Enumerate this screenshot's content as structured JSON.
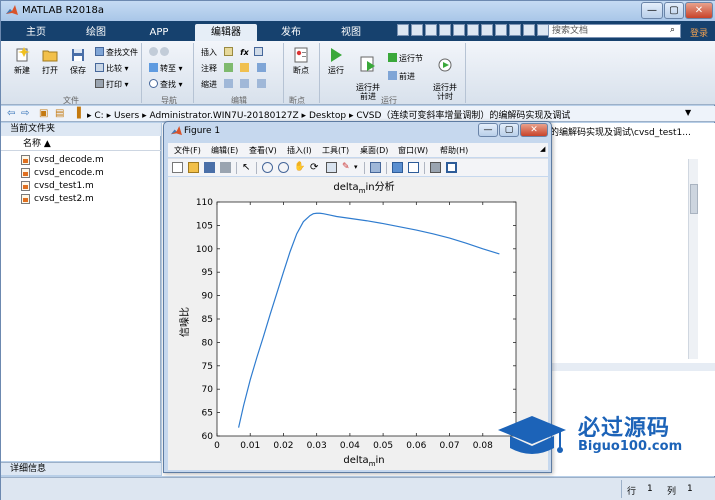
{
  "app": {
    "title": "MATLAB R2018a",
    "window_buttons": [
      "—",
      "▢",
      "✕"
    ]
  },
  "tabs": [
    {
      "label": "主页"
    },
    {
      "label": "绘图"
    },
    {
      "label": "APP"
    },
    {
      "label": "编辑器"
    },
    {
      "label": "发布"
    },
    {
      "label": "视图"
    }
  ],
  "search": {
    "placeholder": "搜索文档"
  },
  "login_label": "登录",
  "ribbon": {
    "file_group": {
      "label": "文件",
      "new": "新建",
      "open": "打开",
      "save": "保存",
      "find_files": "查找文件",
      "compare": "比较",
      "print": "打印"
    },
    "nav_group": {
      "label": "导航",
      "goto": "转至",
      "find": "查找"
    },
    "edit_group": {
      "label": "编辑",
      "insert": "插入",
      "comment": "注释",
      "indent": "缩进"
    },
    "breakpoint_group": {
      "label": "断点",
      "breakpoints": "断点"
    },
    "run_group": {
      "label": "运行",
      "run": "运行",
      "run_advance": "运行并\n前进",
      "run_section": "运行节",
      "advance": "前进",
      "run_time": "运行并\n计时"
    }
  },
  "address": {
    "segments": [
      "C:",
      "Users",
      "Administrator.WIN7U-20180127Z",
      "Desktop",
      "CVSD（连续可变斜率增量调制）的编解码实现及调试"
    ]
  },
  "left_panel": {
    "header": "当前文件夹",
    "column": "名称 ▲",
    "files": [
      "cvsd_decode.m",
      "cvsd_encode.m",
      "cvsd_test1.m",
      "cvsd_test2.m"
    ],
    "detail_header": "详细信息"
  },
  "right_title": "的编解码实现及调试\\cvsd_test1...",
  "status": {
    "row_label": "行",
    "row_value": "1",
    "col_label": "列",
    "col_value": "1"
  },
  "figure": {
    "title": "Figure 1",
    "menus": [
      "文件(F)",
      "编辑(E)",
      "查看(V)",
      "插入(I)",
      "工具(T)",
      "桌面(D)",
      "窗口(W)",
      "帮助(H)"
    ],
    "window_buttons": [
      "—",
      "▢",
      "✕"
    ]
  },
  "chart_data": {
    "type": "line",
    "title_main": "delta",
    "title_sub": "m",
    "title_rest": "in分析",
    "xlabel_main": "delta",
    "xlabel_sub": "m",
    "xlabel_rest": "in",
    "ylabel": "信噪比",
    "xlim": [
      0,
      0.09
    ],
    "ylim": [
      60,
      110
    ],
    "xticks": [
      0,
      0.01,
      0.02,
      0.03,
      0.04,
      0.05,
      0.06,
      0.07,
      0.08
    ],
    "xtick_labels": [
      "0",
      "0.01",
      "0.02",
      "0.03",
      "0.04",
      "0.05",
      "0.06",
      "0.07",
      "0.08"
    ],
    "yticks": [
      60,
      65,
      70,
      75,
      80,
      85,
      90,
      95,
      100,
      105,
      110
    ],
    "ytick_labels": [
      "60",
      "65",
      "70",
      "75",
      "80",
      "85",
      "90",
      "95",
      "100",
      "105",
      "110"
    ],
    "series": [
      {
        "color": "#2f7ccf",
        "x": [
          0.0065,
          0.008,
          0.01,
          0.012,
          0.014,
          0.016,
          0.018,
          0.02,
          0.022,
          0.024,
          0.026,
          0.028,
          0.029,
          0.03,
          0.031,
          0.032,
          0.034,
          0.036,
          0.04,
          0.045,
          0.05,
          0.055,
          0.06,
          0.065,
          0.07,
          0.075,
          0.08,
          0.085
        ],
        "y": [
          61.8,
          66.5,
          72,
          76.8,
          81.3,
          86,
          90.5,
          95,
          99.4,
          103.2,
          105.8,
          107.1,
          107.5,
          107.6,
          107.6,
          107.5,
          107.2,
          106.9,
          106.5,
          106,
          105.4,
          104.7,
          104,
          103.2,
          102.3,
          101.2,
          100,
          98.9
        ]
      }
    ],
    "grid": false
  },
  "watermark": {
    "title": "必过源码",
    "sub": "Biguo100.com"
  },
  "colors": {
    "accent_blue": "#16416e",
    "watermark_blue": "#1c63b8",
    "line_blue": "#2f7ccf"
  }
}
